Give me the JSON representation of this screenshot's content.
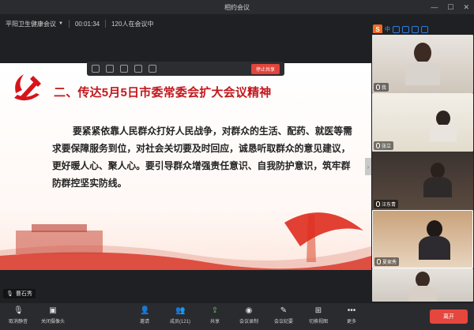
{
  "window": {
    "title": "相约会议"
  },
  "infobar": {
    "meeting_name": "平阳卫生健康会议",
    "timer": "00:01:34",
    "attendees": "120人在会议中"
  },
  "share_toolbar": {
    "stop_label": "停止共享"
  },
  "slide": {
    "heading": "二、传达5月5日市委常委会扩大会议精神",
    "body": "要紧紧依靠人民群众打好人民战争，对群众的生活、配药、就医等需求要保障服务到位，对社会关切要及时回应，诚恳听取群众的意见建议，更好暖人心、聚人心。要引导群众增强责任意识、自我防护意识，筑牢群防群控坚实防线。"
  },
  "speaker": {
    "name": "曹石秀"
  },
  "gallery": {
    "tiles": [
      {
        "name": "我"
      },
      {
        "name": "张立"
      },
      {
        "name": "汪东青"
      },
      {
        "name": "夏家秀"
      },
      {
        "name": ""
      }
    ]
  },
  "toolbar": {
    "buttons": [
      {
        "label": "取消静音",
        "icon": "mic-icon"
      },
      {
        "label": "关闭摄像头",
        "icon": "camera-icon"
      },
      {
        "label": "邀请",
        "icon": "invite-icon"
      },
      {
        "label": "成员(121)",
        "icon": "members-icon"
      },
      {
        "label": "共享",
        "icon": "share-icon"
      },
      {
        "label": "会议录制",
        "icon": "record-icon"
      },
      {
        "label": "会议纪要",
        "icon": "notes-icon"
      },
      {
        "label": "切换视图",
        "icon": "view-icon"
      },
      {
        "label": "更多",
        "icon": "more-icon"
      }
    ],
    "leave_label": "离开"
  },
  "colors": {
    "accent_red": "#c2171c",
    "leave": "#e5463d",
    "bg": "#1f2023"
  }
}
